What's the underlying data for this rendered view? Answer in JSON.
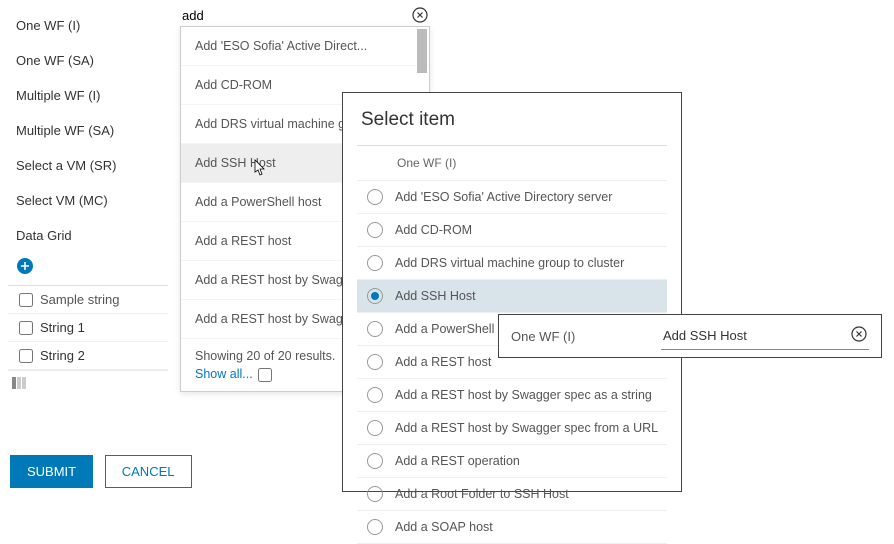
{
  "nav": {
    "items": [
      "One WF (I)",
      "One WF (SA)",
      "Multiple WF (I)",
      "Multiple WF (SA)",
      "Select a VM (SR)",
      "Select VM (MC)",
      "Data Grid"
    ]
  },
  "table": {
    "header": "Sample string",
    "rows": [
      "String 1",
      "String 2"
    ]
  },
  "buttons": {
    "submit": "SUBMIT",
    "cancel": "CANCEL"
  },
  "search": {
    "value": "add"
  },
  "dropdown": {
    "items": [
      "Add 'ESO Sofia' Active Direct...",
      "Add CD-ROM",
      "Add DRS virtual machine gro...",
      "Add SSH Host",
      "Add a PowerShell host",
      "Add a REST host",
      "Add a REST host by Swagger ...",
      "Add a REST host by Swagger ..."
    ],
    "hoverIndex": 3,
    "results_text": "Showing 20 of 20 results.",
    "show_all": "Show all..."
  },
  "modal": {
    "title": "Select item",
    "subhead": "One WF (I)",
    "items": [
      "Add 'ESO Sofia' Active Directory server",
      "Add CD-ROM",
      "Add DRS virtual machine group to cluster",
      "Add SSH Host",
      "Add a PowerShell host",
      "Add a REST host",
      "Add a REST host by Swagger spec as a string",
      "Add a REST host by Swagger spec from a URL",
      "Add a REST operation",
      "Add a Root Folder to SSH Host",
      "Add a SOAP host"
    ],
    "selectedIndex": 3
  },
  "flyout": {
    "label": "One WF (I)",
    "value": "Add SSH Host"
  }
}
